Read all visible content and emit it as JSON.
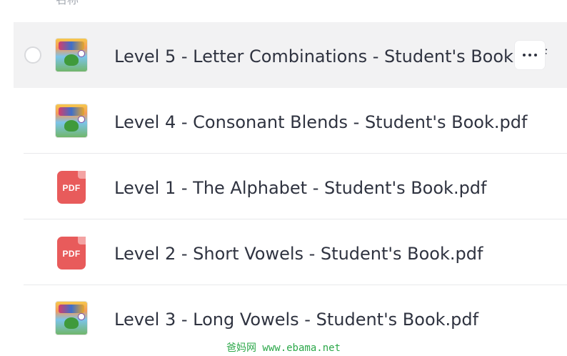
{
  "list": {
    "column_header": "名称",
    "files": [
      {
        "name": "Level 5 - Letter Combinations - Student's Book.pdf",
        "thumbnail": "book-cover",
        "selected": true
      },
      {
        "name": "Level 4 - Consonant Blends - Student's Book.pdf",
        "thumbnail": "book-cover",
        "selected": false
      },
      {
        "name": "Level 1 - The Alphabet - Student's Book.pdf",
        "thumbnail": "pdf-icon",
        "selected": false
      },
      {
        "name": "Level 2 - Short Vowels - Student's Book.pdf",
        "thumbnail": "pdf-icon",
        "selected": false
      },
      {
        "name": "Level 3 - Long Vowels - Student's Book.pdf",
        "thumbnail": "book-cover",
        "selected": false
      }
    ],
    "pdf_icon_label": "PDF",
    "row_actions_icon": "more-horizontal-icon"
  },
  "watermark": "爸妈网 www.ebama.net",
  "colors": {
    "selected_row_bg": "#f2f2f3",
    "pdf_red": "#e85b5b",
    "text": "#2f3340",
    "divider": "#e8e9eb",
    "watermark": "#2ca84a"
  }
}
